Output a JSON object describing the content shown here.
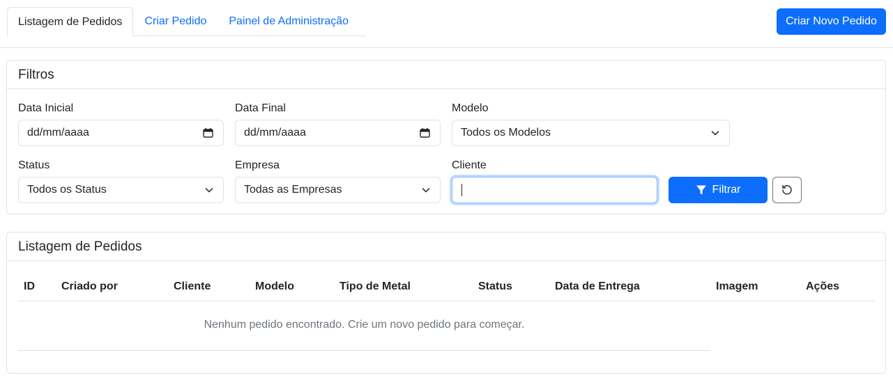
{
  "nav": {
    "tabs": [
      {
        "label": "Listagem de Pedidos"
      },
      {
        "label": "Criar Pedido"
      },
      {
        "label": "Painel de Administração"
      }
    ],
    "create_button": "Criar Novo Pedido"
  },
  "filters": {
    "title": "Filtros",
    "start_date": {
      "label": "Data Inicial",
      "value": "dd/mm/aaaa"
    },
    "end_date": {
      "label": "Data Final",
      "value": "dd/mm/aaaa"
    },
    "model": {
      "label": "Modelo",
      "value": "Todos os Modelos"
    },
    "status": {
      "label": "Status",
      "value": "Todos os Status"
    },
    "company": {
      "label": "Empresa",
      "value": "Todas as Empresas"
    },
    "client": {
      "label": "Cliente",
      "value": ""
    },
    "filter_button": "Filtrar",
    "reset_icon": "reset-icon"
  },
  "orders": {
    "title": "Listagem de Pedidos",
    "columns": [
      "ID",
      "Criado por",
      "Cliente",
      "Modelo",
      "Tipo de Metal",
      "Status",
      "Data de Entrega",
      "Imagem",
      "Ações"
    ],
    "empty_message": "Nenhum pedido encontrado. Crie um novo pedido para começar."
  },
  "colors": {
    "primary": "#0d6efd",
    "border": "#dee2e6",
    "muted": "#6c757d"
  }
}
